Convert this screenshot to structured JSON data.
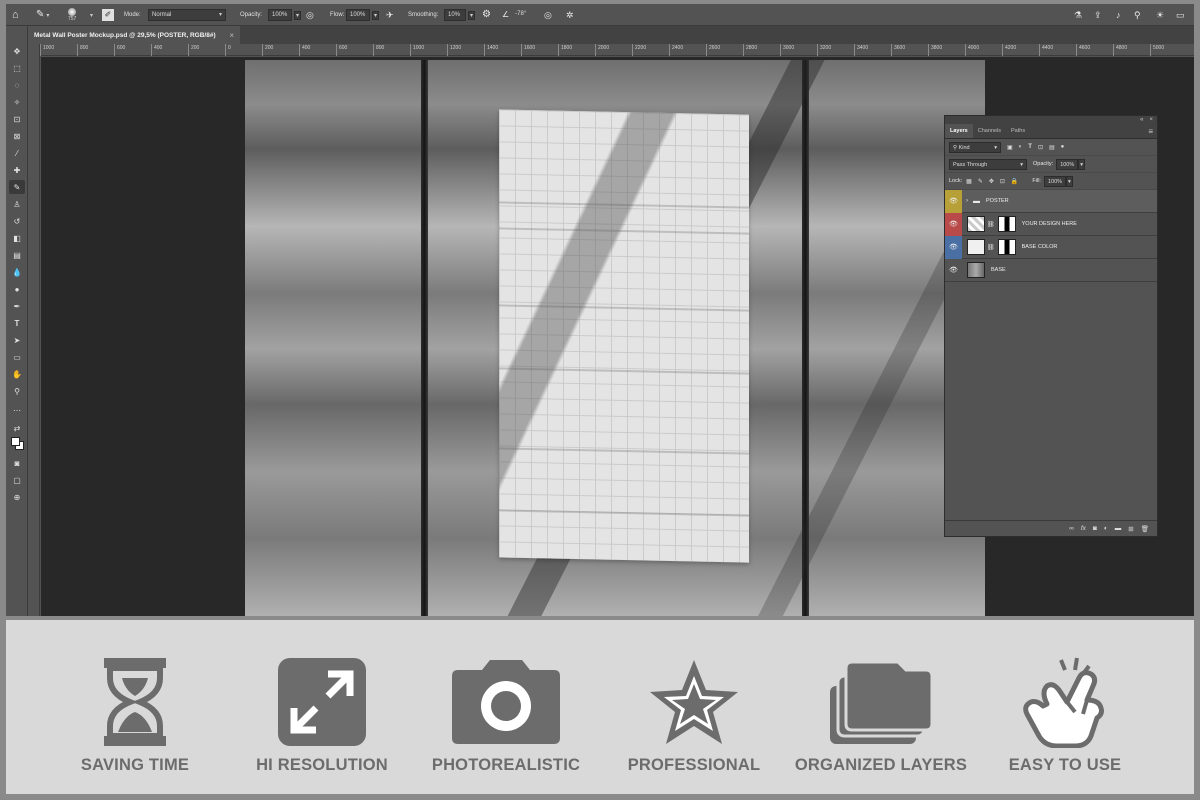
{
  "options_bar": {
    "brush_size": "757",
    "mode_label": "Mode:",
    "mode_value": "Normal",
    "opacity_label": "Opacity:",
    "opacity_value": "100%",
    "flow_label": "Flow:",
    "flow_value": "100%",
    "smoothing_label": "Smoothing:",
    "smoothing_value": "10%",
    "angle_value": "-78°"
  },
  "document": {
    "tab_title": "Metal Wall Poster Mockup.psd @ 29,5% (POSTER, RGB/8#)",
    "tab_close": "×"
  },
  "ruler": {
    "h_ticks": [
      "1000",
      "800",
      "600",
      "400",
      "200",
      "0",
      "200",
      "400",
      "600",
      "800",
      "1000",
      "1200",
      "1400",
      "1600",
      "1800",
      "2000",
      "2200",
      "2400",
      "2600",
      "2800",
      "3000",
      "3200",
      "3400",
      "3600",
      "3800",
      "4000",
      "4200",
      "4400",
      "4600",
      "4800",
      "5000"
    ]
  },
  "layers_panel": {
    "tabs": [
      "Layers",
      "Channels",
      "Paths"
    ],
    "filter_kind": "Kind",
    "blend_mode": "Pass Through",
    "opacity_label": "Opacity:",
    "opacity_value": "100%",
    "lock_label": "Lock:",
    "fill_label": "Fill:",
    "fill_value": "100%",
    "layers": [
      {
        "name": "POSTER",
        "color": "#b8a038"
      },
      {
        "name": "YOUR DESIGN HERE",
        "color": "#b94a4a"
      },
      {
        "name": "BASE COLOR",
        "color": "#4a6fa5"
      },
      {
        "name": "BASE",
        "color": "#535353"
      }
    ]
  },
  "features": [
    {
      "label": "SAVING TIME",
      "icon": "hourglass-icon"
    },
    {
      "label": "HI RESOLUTION",
      "icon": "expand-arrows-icon"
    },
    {
      "label": "PHOTOREALISTIC",
      "icon": "camera-icon"
    },
    {
      "label": "PROFESSIONAL",
      "icon": "star-icon"
    },
    {
      "label": "ORGANIZED LAYERS",
      "icon": "layers-folder-icon"
    },
    {
      "label": "EASY TO USE",
      "icon": "tap-hand-icon"
    }
  ],
  "colors": {
    "feature_gray": "#6c6c6c",
    "feature_bg": "#d9d9d9",
    "ps_panel": "#535353",
    "workspace": "#282828"
  }
}
